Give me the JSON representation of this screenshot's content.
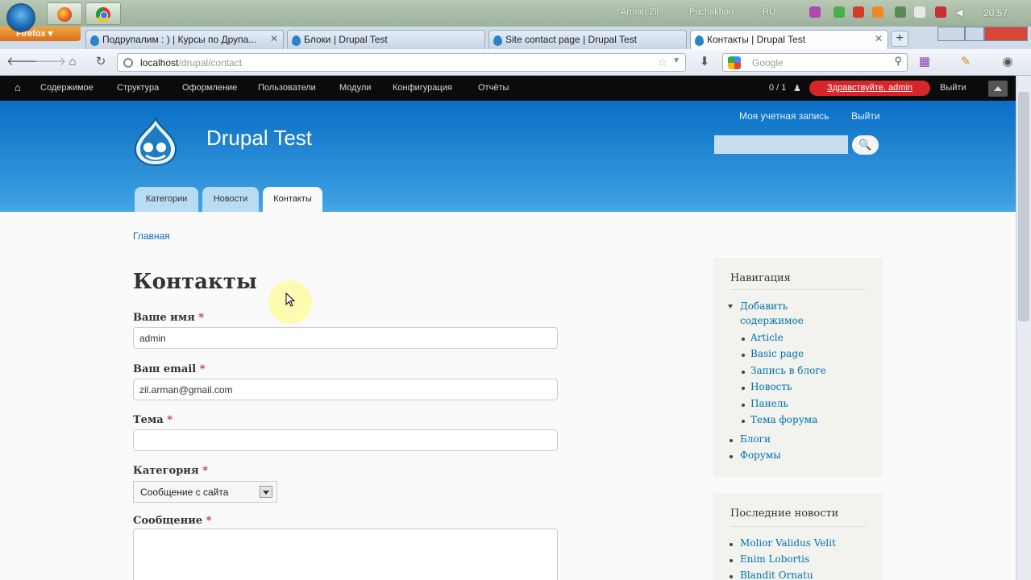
{
  "taskbar": {
    "user_name": "Arman Zil",
    "user_name2": "Puchakhon",
    "language": "RU",
    "clock": "20:57"
  },
  "browser": {
    "menu_label": "Firefox",
    "tabs": [
      {
        "label": "Подрупалим : ) | Курсы по Друпа..."
      },
      {
        "label": "Блоки | Drupal Test"
      },
      {
        "label": "Site contact page | Drupal Test"
      },
      {
        "label": "Контакты | Drupal Test"
      }
    ],
    "url_host": "localhost",
    "url_path": "/drupal/contact",
    "search_placeholder": "Google"
  },
  "admin_toolbar": {
    "items": [
      "Содержимое",
      "Структура",
      "Оформление",
      "Пользователи",
      "Модули",
      "Конфигурация",
      "Отчёты"
    ],
    "counter": "0 / 1",
    "hello": "Здравствуйте, admin",
    "logout": "Выйти"
  },
  "header": {
    "site_name": "Drupal Test",
    "account_link": "Моя учетная запись",
    "logout_link": "Выйти",
    "search_button": "🔍",
    "tabs": [
      "Категории",
      "Новости",
      "Контакты"
    ]
  },
  "content": {
    "breadcrumb": "Главная",
    "title": "Контакты",
    "required_mark": "*",
    "fields": {
      "name": {
        "label": "Ваше имя",
        "value": "admin"
      },
      "email": {
        "label": "Ваш email",
        "value": "zil.arman@gmail.com"
      },
      "subject": {
        "label": "Тема",
        "value": ""
      },
      "category": {
        "label": "Категория",
        "value": "Сообщение с сайта"
      },
      "message": {
        "label": "Сообщение",
        "value": ""
      }
    }
  },
  "sidebar": {
    "navigation": {
      "title": "Навигация",
      "add_content_line1": "Добавить",
      "add_content_line2": "содержимое",
      "sub_items": [
        "Article",
        "Basic page",
        "Запись в блоге",
        "Новость",
        "Панель",
        "Тема форума"
      ],
      "items": [
        "Блоги",
        "Форумы"
      ]
    },
    "news": {
      "title": "Последние новости",
      "items": [
        "Molior Validus Velit",
        "Enim Lobortis",
        "Blandit Ornatu"
      ]
    }
  }
}
